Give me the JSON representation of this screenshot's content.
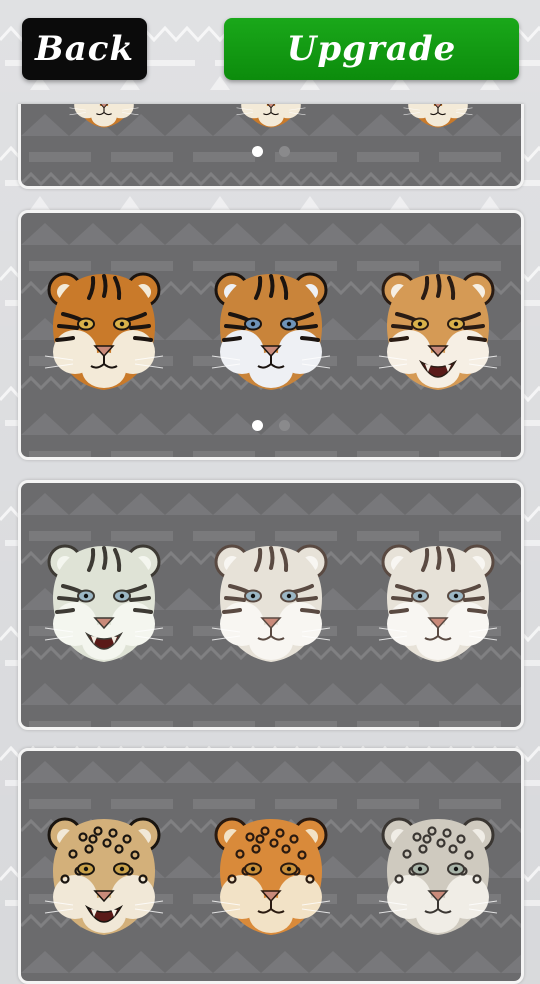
{
  "header": {
    "back_label": "Back",
    "upgrade_label": "Upgrade"
  },
  "colors": {
    "upgrade": "#15a015",
    "back": "#0b0b0b",
    "card_bg": "#6b6b6d",
    "dot_active": "#ffffff",
    "dot_inactive": "#8a8a8c"
  },
  "packs": [
    {
      "id": "pack-1",
      "heads": [
        "tiger-head-icon",
        "tiger-head-icon",
        "tiger-head-icon"
      ],
      "page": 1,
      "pages": 2
    },
    {
      "id": "pack-2",
      "heads": [
        "bengal-tiger-head-icon",
        "blue-eyed-tiger-head-icon",
        "roaring-tiger-head-icon"
      ],
      "page": 1,
      "pages": 2
    },
    {
      "id": "pack-3",
      "heads": [
        "roaring-white-tiger-head-icon",
        "white-tiger-head-icon",
        "white-tiger-head-icon"
      ]
    },
    {
      "id": "pack-4",
      "heads": [
        "snarling-leopard-head-icon",
        "jaguar-head-icon",
        "snow-leopard-head-icon"
      ]
    }
  ]
}
